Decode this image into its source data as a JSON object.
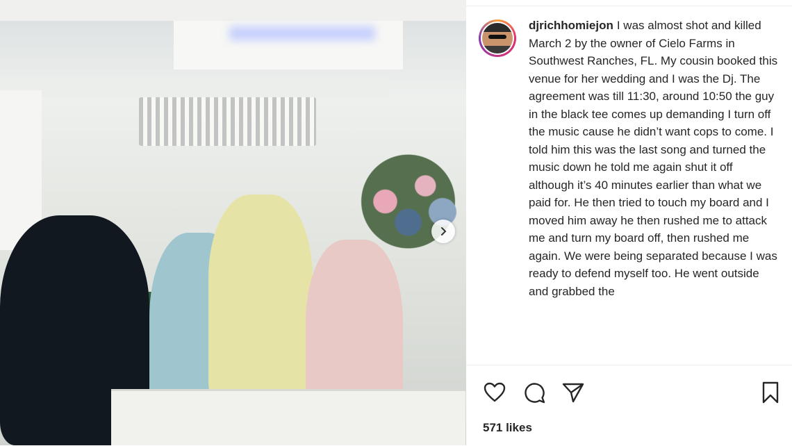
{
  "post": {
    "username": "djrichhomiejon",
    "caption": "I was almost shot and killed March 2 by the owner of Cielo Farms in Southwest Ranches, FL. My cousin booked this venue for her wedding and I was the Dj. The agreement was till 11:30, around 10:50 the guy in the black tee comes up demanding I turn off the music cause he didn’t want cops to come. I told him this was the last song and turned the music down he told me again shut it off although it’s 40 minutes earlier than what we paid for. He then tried to touch my board and I moved him away he then rushed me to attack me and turn my board off, then rushed me again. We were being separated because I was ready to defend myself too. He went outside and grabbed the",
    "likes": "571 likes"
  },
  "actions": {
    "icons": [
      "heart-icon",
      "comment-icon",
      "share-icon",
      "bookmark-icon"
    ]
  },
  "media": {
    "next_icon": "chevron-right-icon"
  },
  "colors": {
    "text": "#262626",
    "avatar_ring_start": "#f9a03c",
    "avatar_ring_end": "#c13584"
  }
}
